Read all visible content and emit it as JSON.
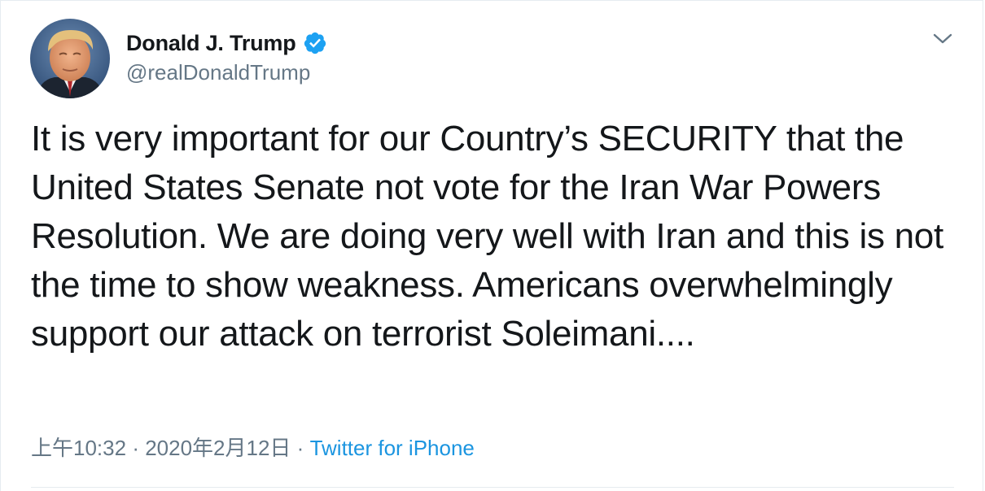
{
  "tweet": {
    "display_name": "Donald J. Trump",
    "handle": "@realDonaldTrump",
    "verified": true,
    "text": "It is very important for our Country’s SECURITY that the United States Senate not vote for the Iran War Powers Resolution. We are doing very well with Iran and this is not the time to show weakness. Americans overwhelmingly support our attack on terrorist Soleimani....",
    "time": "上午10:32",
    "date": "2020年2月12日",
    "separator": "·",
    "source": "Twitter for iPhone"
  },
  "icons": {
    "avatar": "profile-photo",
    "verified": "verified-badge-icon",
    "menu": "chevron-down-icon"
  },
  "colors": {
    "text": "#14171a",
    "secondary": "#657786",
    "link": "#1b95e0",
    "verified": "#1da1f2",
    "border": "#e6ecf0"
  }
}
